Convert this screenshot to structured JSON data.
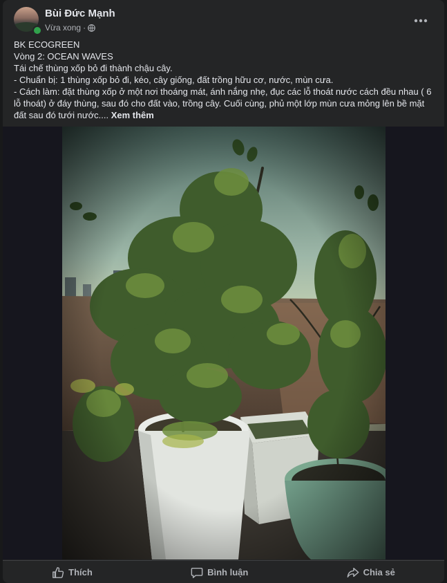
{
  "post": {
    "author": "Bùi Đức Mạnh",
    "timestamp": "Vừa xong",
    "separator": "·",
    "privacy_icon": "globe-icon",
    "text_lines": [
      "BK ECOGREEN",
      "Vòng 2: OCEAN WAVES",
      "Tái chế thùng xốp bỏ đi thành chậu cây.",
      "- Chuẩn bị: 1 thùng xốp bỏ đi, kéo, cây giống, đất trồng hữu cơ, nước, mùn cưa.",
      "- Cách làm: đặt thùng xốp ở một nơi thoáng mát, ánh nắng nhẹ, đục các lỗ thoát nước cách đều nhau ( 6 lỗ thoát) ở đáy thùng, sau đó cho đất vào, trồng cây. Cuối cùng, phủ một lớp mùn cưa mỏng lên bề mặt đất sau đó tưới nước...."
    ],
    "see_more": "Xem thêm",
    "more_menu_icon": "more-options-icon"
  },
  "actions": {
    "like": "Thích",
    "comment": "Bình luận",
    "share": "Chia sẻ"
  },
  "colors": {
    "card_bg": "#242526",
    "page_bg": "#18191a",
    "text_primary": "#e4e6eb",
    "text_secondary": "#b0b3b8",
    "online": "#31a24c"
  }
}
